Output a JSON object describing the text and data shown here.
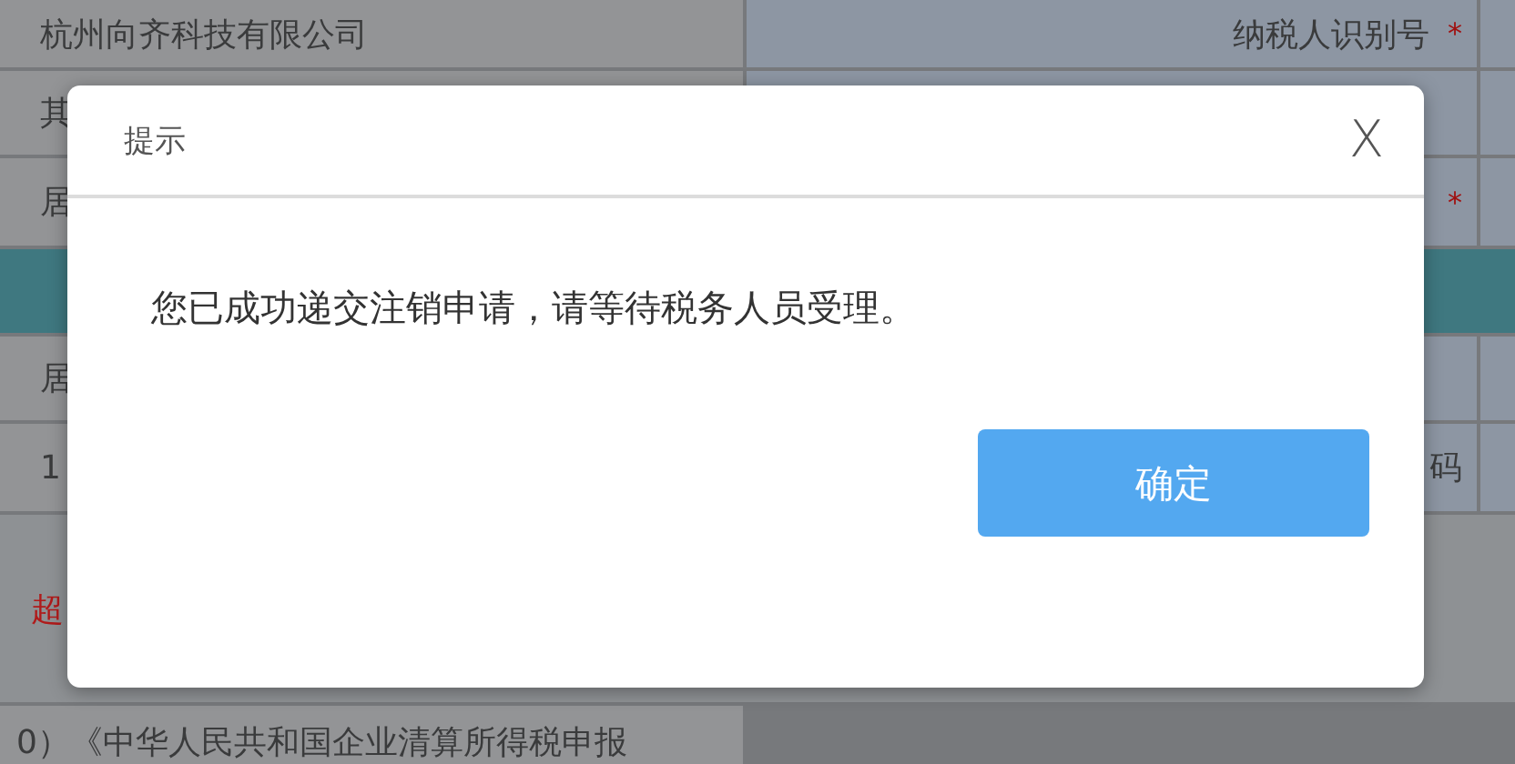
{
  "form": {
    "rows": [
      {
        "kind": "fields",
        "cells": [
          {
            "kind": "value",
            "text": "杭州向齐科技有限公司"
          },
          {
            "kind": "label",
            "text": "纳税人识别号",
            "mark": "*"
          }
        ]
      },
      {
        "kind": "fields",
        "cells": [
          {
            "kind": "value",
            "text": "其"
          },
          {
            "kind": "label"
          }
        ]
      },
      {
        "kind": "fields",
        "cells": [
          {
            "kind": "value",
            "text": "居"
          },
          {
            "kind": "label",
            "mark": "*"
          }
        ]
      },
      {
        "kind": "section"
      },
      {
        "kind": "fields",
        "cells": [
          {
            "kind": "value",
            "text": "居"
          },
          {
            "kind": "label"
          }
        ]
      },
      {
        "kind": "fields",
        "cells": [
          {
            "kind": "value",
            "text": "1"
          },
          {
            "kind": "label",
            "text": "码"
          }
        ]
      },
      {
        "kind": "note",
        "text": "超"
      },
      {
        "kind": "text",
        "text": "0）《中华人民共和国企业清算所得税申报"
      }
    ]
  },
  "dialog": {
    "title": "提示",
    "close": "X",
    "message": "您已成功递交注销申请，请等待税务人员受理。",
    "buttons": [
      "确定"
    ]
  }
}
